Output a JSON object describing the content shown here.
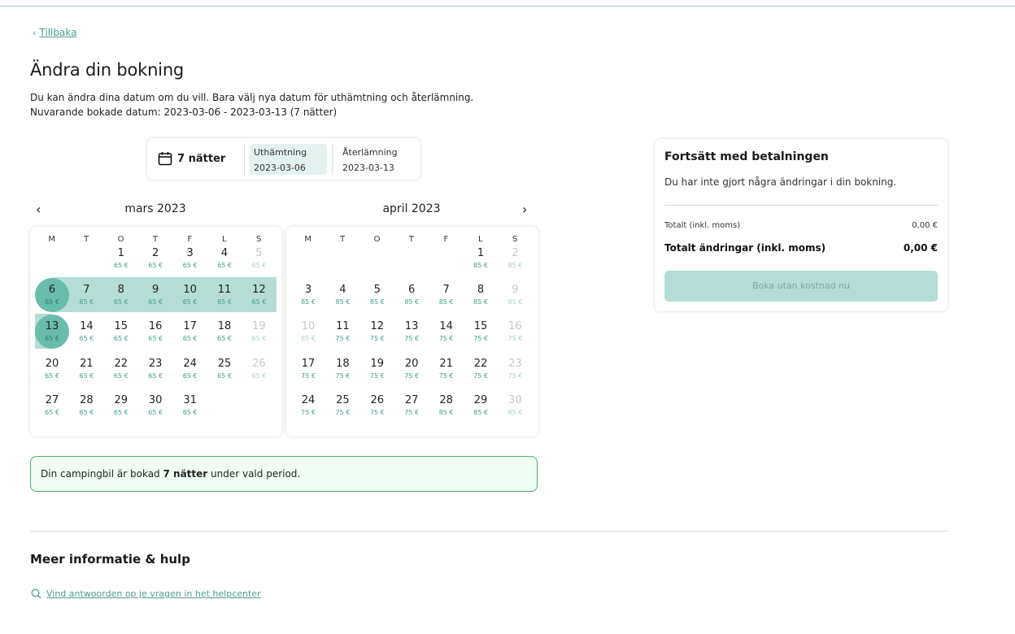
{
  "back": {
    "label": "Tillbaka"
  },
  "page": {
    "title": "Ändra din bokning",
    "intro_line1": "Du kan ändra dina datum om du vill. Bara välj nya datum för uthämtning och återlämning.",
    "intro_line2": "Nuvarande bokade datum: 2023-03-06 - 2023-03-13 (7 nätter)"
  },
  "summary": {
    "nights": "7 nätter",
    "pickup_label": "Uthämtning",
    "pickup_value": "2023-03-06",
    "return_label": "Återlämning",
    "return_value": "2023-03-13"
  },
  "calendar": {
    "weekdays": [
      "M",
      "T",
      "O",
      "T",
      "F",
      "L",
      "S"
    ],
    "months": [
      {
        "title": "mars 2023",
        "offset": 2,
        "days": [
          {
            "d": "1",
            "p": "65 €"
          },
          {
            "d": "2",
            "p": "65 €"
          },
          {
            "d": "3",
            "p": "65 €"
          },
          {
            "d": "4",
            "p": "65 €"
          },
          {
            "d": "5",
            "p": "65 €",
            "disabled": true
          },
          {
            "d": "6",
            "p": "65 €",
            "state": "start"
          },
          {
            "d": "7",
            "p": "65 €",
            "state": "in"
          },
          {
            "d": "8",
            "p": "65 €",
            "state": "in"
          },
          {
            "d": "9",
            "p": "65 €",
            "state": "in"
          },
          {
            "d": "10",
            "p": "65 €",
            "state": "in"
          },
          {
            "d": "11",
            "p": "65 €",
            "state": "in"
          },
          {
            "d": "12",
            "p": "65 €",
            "state": "in"
          },
          {
            "d": "13",
            "p": "65 €",
            "state": "end"
          },
          {
            "d": "14",
            "p": "65 €"
          },
          {
            "d": "15",
            "p": "65 €"
          },
          {
            "d": "16",
            "p": "65 €"
          },
          {
            "d": "17",
            "p": "65 €"
          },
          {
            "d": "18",
            "p": "65 €"
          },
          {
            "d": "19",
            "p": "65 €",
            "disabled": true
          },
          {
            "d": "20",
            "p": "65 €"
          },
          {
            "d": "21",
            "p": "65 €"
          },
          {
            "d": "22",
            "p": "65 €"
          },
          {
            "d": "23",
            "p": "65 €"
          },
          {
            "d": "24",
            "p": "65 €"
          },
          {
            "d": "25",
            "p": "65 €"
          },
          {
            "d": "26",
            "p": "65 €",
            "disabled": true
          },
          {
            "d": "27",
            "p": "65 €"
          },
          {
            "d": "28",
            "p": "65 €"
          },
          {
            "d": "29",
            "p": "65 €"
          },
          {
            "d": "30",
            "p": "65 €"
          },
          {
            "d": "31",
            "p": "65 €"
          }
        ]
      },
      {
        "title": "april 2023",
        "offset": 5,
        "days": [
          {
            "d": "1",
            "p": "85 €"
          },
          {
            "d": "2",
            "p": "85 €",
            "disabled": true
          },
          {
            "d": "3",
            "p": "85 €"
          },
          {
            "d": "4",
            "p": "85 €"
          },
          {
            "d": "5",
            "p": "85 €"
          },
          {
            "d": "6",
            "p": "85 €"
          },
          {
            "d": "7",
            "p": "85 €"
          },
          {
            "d": "8",
            "p": "85 €"
          },
          {
            "d": "9",
            "p": "85 €",
            "disabled": true
          },
          {
            "d": "10",
            "p": "85 €",
            "disabled": true
          },
          {
            "d": "11",
            "p": "75 €"
          },
          {
            "d": "12",
            "p": "75 €"
          },
          {
            "d": "13",
            "p": "75 €"
          },
          {
            "d": "14",
            "p": "75 €"
          },
          {
            "d": "15",
            "p": "75 €"
          },
          {
            "d": "16",
            "p": "75 €",
            "disabled": true
          },
          {
            "d": "17",
            "p": "75 €"
          },
          {
            "d": "18",
            "p": "75 €"
          },
          {
            "d": "19",
            "p": "75 €"
          },
          {
            "d": "20",
            "p": "75 €"
          },
          {
            "d": "21",
            "p": "75 €"
          },
          {
            "d": "22",
            "p": "75 €"
          },
          {
            "d": "23",
            "p": "75 €",
            "disabled": true
          },
          {
            "d": "24",
            "p": "75 €"
          },
          {
            "d": "25",
            "p": "75 €"
          },
          {
            "d": "26",
            "p": "75 €"
          },
          {
            "d": "27",
            "p": "75 €"
          },
          {
            "d": "28",
            "p": "85 €"
          },
          {
            "d": "29",
            "p": "85 €"
          },
          {
            "d": "30",
            "p": "85 €",
            "disabled": true
          }
        ]
      }
    ]
  },
  "notice": {
    "before": "Din campingbil är bokad ",
    "bold": "7 nätter",
    "after": " under vald period."
  },
  "payment": {
    "title": "Fortsätt med betalningen",
    "message": "Du har inte gjort några ändringar i din bokning.",
    "total_label": "Totalt (inkl. moms)",
    "total_value": "0,00 €",
    "changes_label": "Totalt ändringar (inkl. moms)",
    "changes_value": "0,00 €",
    "button_label": "Boka utan kostnad nu"
  },
  "help": {
    "title": "Meer informatie & hulp",
    "link_label": "Vind antwoorden op je vragen in het helpcenter"
  },
  "colors": {
    "accent": "#69bcab",
    "range": "#b3ddd5",
    "price": "#3fa08f",
    "link": "#4f9c92",
    "notice_border": "#49b26d"
  }
}
